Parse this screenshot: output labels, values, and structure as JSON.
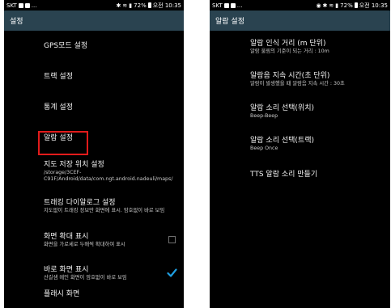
{
  "status_left": {
    "carrier": "SKT",
    "extra": "...",
    "battery": "72%",
    "time": "오전 10:35"
  },
  "status_right": {
    "carrier": "SKT",
    "extra": "...",
    "battery": "72%",
    "time": "오전 10:35"
  },
  "left_screen": {
    "title": "설정",
    "items": [
      {
        "title": "GPS모드 설정"
      },
      {
        "title": "트랙 설정"
      },
      {
        "title": "통계 설정"
      },
      {
        "title": "알람 설정"
      },
      {
        "title": "지도 저장 위치 설정",
        "subtitle": "/storage/3CEF-C91F/Android/data/com.ngt.android.nadeuli/maps/"
      },
      {
        "title": "트래킹 다이알로그 설정",
        "subtitle": "지도없이 트래킹 정보만 화면에 표시. 암호없이 바로 보임"
      },
      {
        "title": "화면 확대 표시",
        "subtitle": "화면을 가로세로 두배씩 확대하여 표시",
        "checked": false
      },
      {
        "title": "바로 화면 표시",
        "subtitle": "산길샘 메인 화면이 암호없이 바로 보임",
        "checked": true
      },
      {
        "title": "플래시 화면"
      }
    ]
  },
  "right_screen": {
    "title": "알람 설정",
    "items": [
      {
        "title": "알람 인식 거리 (m 단위)",
        "subtitle": "알람 울림의 기준이 되는 거리 : 10m"
      },
      {
        "title": "알람음 지속 시간(초 단위)",
        "subtitle": "알람이 발생했을 때 알람음 지속 시간 : 30초"
      },
      {
        "title": "알람 소리 선택(위치)",
        "subtitle": "Beep-Beep"
      },
      {
        "title": "알람 소리 선택(트랙)",
        "subtitle": "Beep Once"
      },
      {
        "title": "TTS 알람 소리 만들기"
      }
    ]
  },
  "colors": {
    "titlebar": "#2a4350",
    "highlight": "#e21b1b",
    "checkmark": "#1f9ee0"
  }
}
